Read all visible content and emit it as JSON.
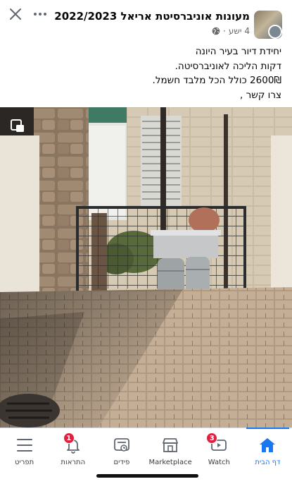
{
  "header": {
    "group_name": "מעונות אוניברסיטת אריאל 2022/2023",
    "post_time": "4 ישע",
    "post_time_separator": "·"
  },
  "post": {
    "lines": [
      "יחידת דיור בעיר היונה",
      "דקות הליכה לאוניברסיטה.",
      "2600₪ כולל הכל מלבד חשמל.",
      "צרו קשר ,"
    ]
  },
  "nav": {
    "items": [
      {
        "id": "home",
        "label": "דף הבית",
        "icon": "home-icon",
        "active": true,
        "badge": ""
      },
      {
        "id": "watch",
        "label": "Watch",
        "icon": "watch-icon",
        "active": false,
        "badge": "3"
      },
      {
        "id": "marketplace",
        "label": "Marketplace",
        "icon": "marketplace-icon",
        "active": false,
        "badge": ""
      },
      {
        "id": "feeds",
        "label": "פידים",
        "icon": "feeds-icon",
        "active": false,
        "badge": ""
      },
      {
        "id": "notifications",
        "label": "התראות",
        "icon": "bell-icon",
        "active": false,
        "badge": "1"
      },
      {
        "id": "menu",
        "label": "תפריט",
        "icon": "menu-icon",
        "active": false,
        "badge": ""
      }
    ]
  },
  "colors": {
    "accent": "#1877f2",
    "badge": "#e41e3f",
    "secondary_text": "#65676b"
  }
}
